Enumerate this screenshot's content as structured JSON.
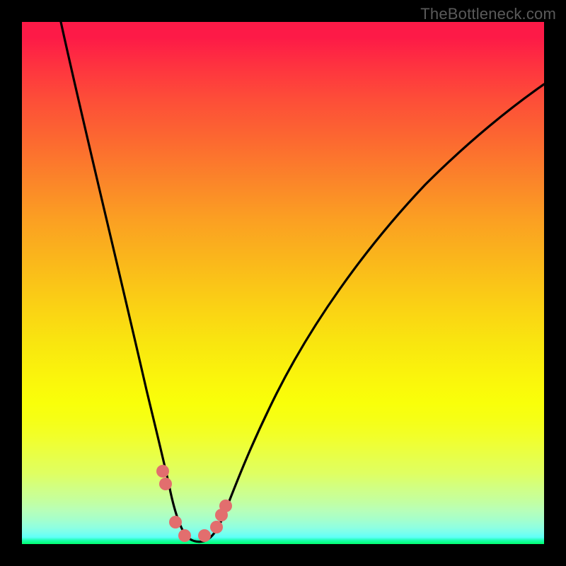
{
  "watermark": "TheBottleneck.com",
  "chart_data": {
    "type": "line",
    "title": "",
    "xlabel": "",
    "ylabel": "",
    "xlim": [
      0,
      100
    ],
    "ylim": [
      0,
      100
    ],
    "grid": false,
    "legend": false,
    "series": [
      {
        "name": "curve",
        "x": [
          7.5,
          14,
          21,
          24.5,
          27,
          28.5,
          29.8,
          31.2,
          33,
          35,
          37.2,
          38.2,
          39,
          40.5,
          45.5,
          53,
          62,
          74,
          88,
          100
        ],
        "y": [
          100,
          74,
          45,
          27,
          14,
          6.8,
          3.4,
          1.6,
          0.6,
          0.6,
          1.6,
          3.2,
          6.2,
          10.5,
          24,
          41,
          57,
          71.5,
          82.5,
          89
        ]
      }
    ],
    "markers": [
      {
        "x": 27.0,
        "y": 14.0
      },
      {
        "x": 27.5,
        "y": 11.5
      },
      {
        "x": 29.4,
        "y": 4.2
      },
      {
        "x": 31.2,
        "y": 1.6
      },
      {
        "x": 35.0,
        "y": 1.6
      },
      {
        "x": 37.2,
        "y": 3.2
      },
      {
        "x": 38.2,
        "y": 5.5
      },
      {
        "x": 39.0,
        "y": 7.3
      }
    ],
    "marker_color": "#e26e6e"
  }
}
